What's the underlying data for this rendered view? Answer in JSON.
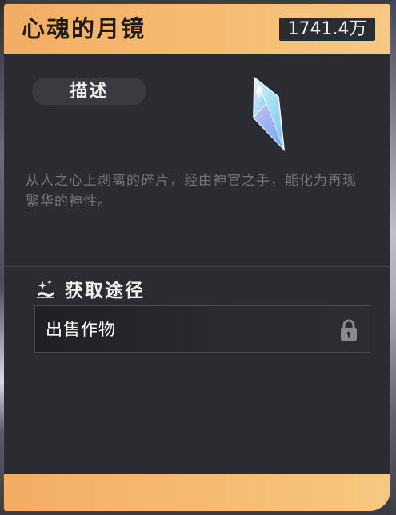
{
  "item": {
    "title": "心魂的月镜",
    "price": "1741.4万"
  },
  "tabs": {
    "description_label": "描述"
  },
  "description": {
    "text": "从人之心上剥离的碎片，经由神官之手，能化为再现繁华的神性。"
  },
  "acquire": {
    "label": "获取途径",
    "items": [
      {
        "label": "出售作物",
        "locked": true
      }
    ]
  },
  "icons": {
    "item_icon": "crystal-shard-icon",
    "source_icon": "sparkle-hand-icon",
    "lock_icon": "lock-icon"
  },
  "colors": {
    "accent": "#f6bc72",
    "panel": "#2b2c32",
    "muted_text": "#75767c"
  }
}
